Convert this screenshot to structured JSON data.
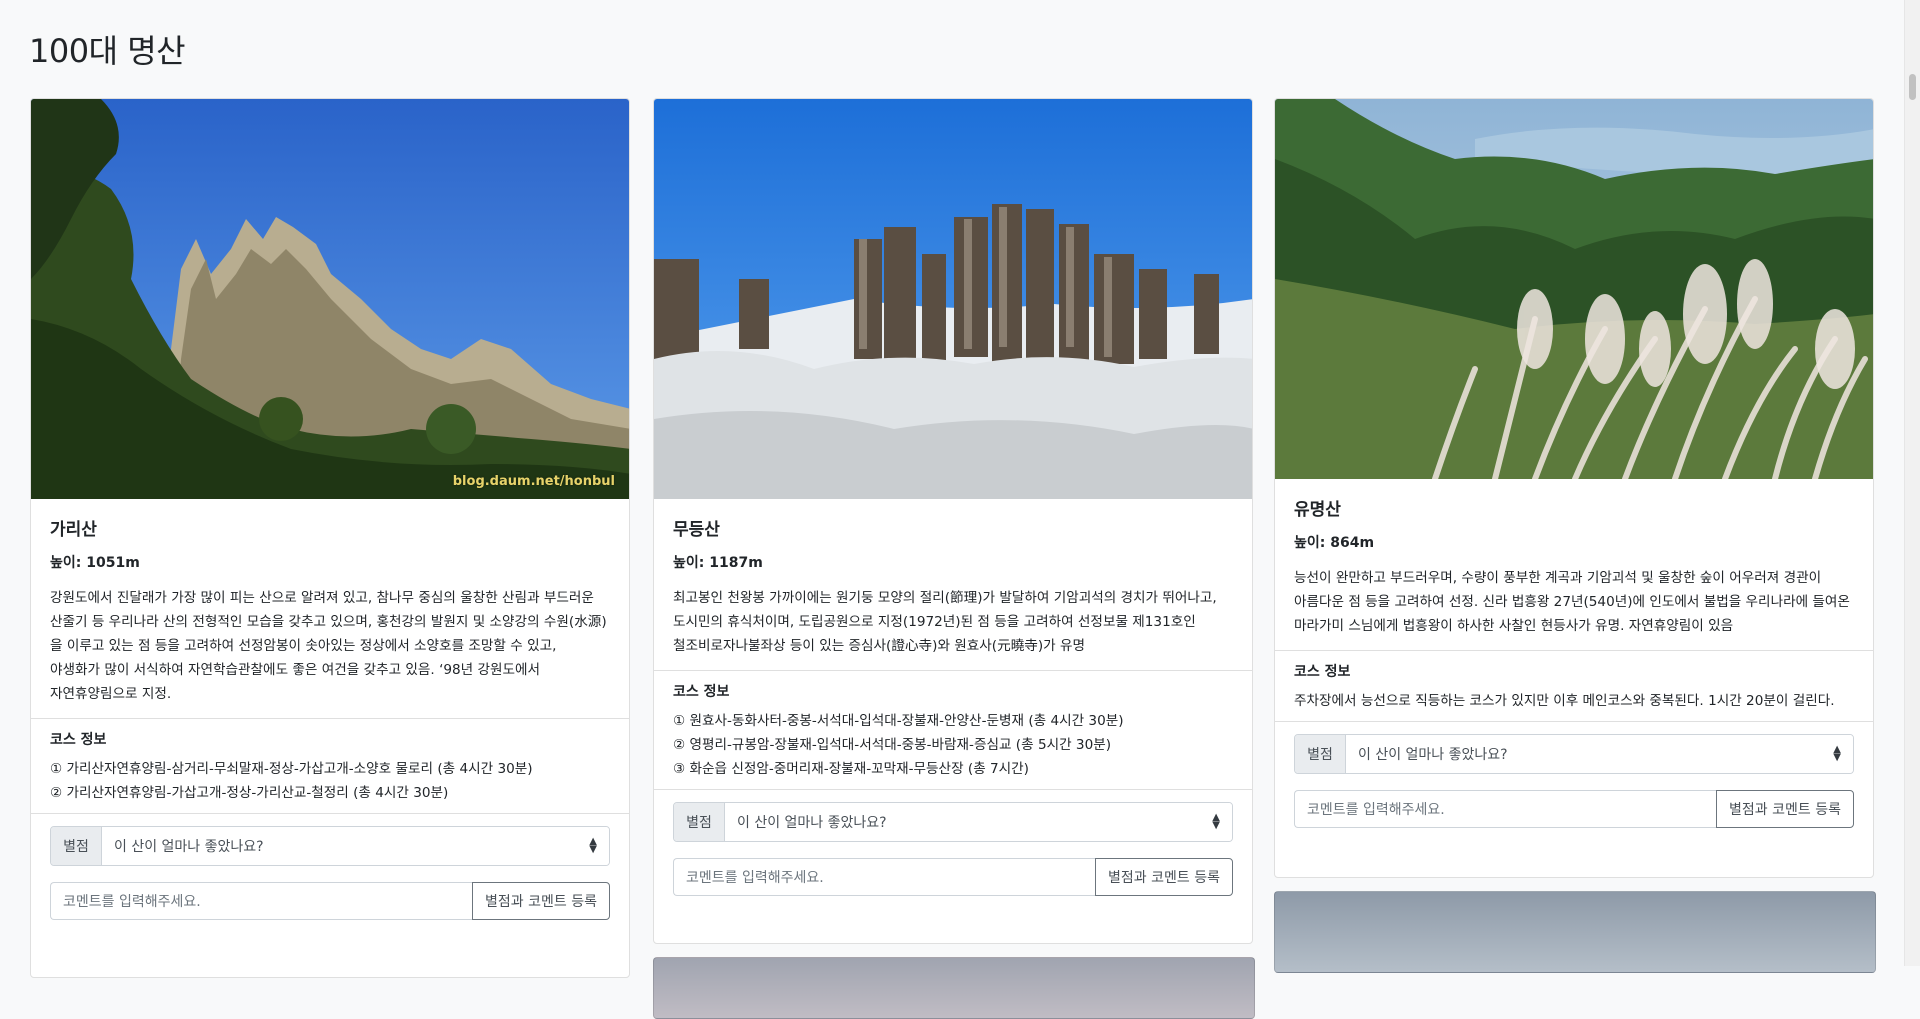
{
  "page": {
    "title": "100대 명산"
  },
  "form": {
    "rating_label": "별점",
    "rating_placeholder": "이 산이 얼마나 좋았나요?",
    "comment_placeholder": "코멘트를 입력해주세요.",
    "submit_label": "별점과 코멘트 등록"
  },
  "cards": [
    {
      "name": "가리산",
      "height": "높이: 1051m",
      "description": "강원도에서 진달래가 가장 많이 피는 산으로 알려져 있고, 참나무 중심의 울창한 산림과 부드러운 산줄기 등 우리나라 산의 전형적인 모습을 갖추고 있으며, 홍천강의 발원지 및 소양강의 수원(水源)을 이루고 있는 점 등을 고려하여 선정암봉이 솟아있는 정상에서 소양호를 조망할 수 있고, 야생화가 많이 서식하여 자연학습관찰에도 좋은 여건을 갖추고 있음. ‘98년 강원도에서 자연휴양림으로 지정.",
      "course_title": "코스 정보",
      "courses": [
        "① 가리산자연휴양림-삼거리-무쇠말재-정상-가삽고개-소양호 물로리 (총 4시간 30분)",
        "② 가리산자연휴양림-가삽고개-정상-가리산교-철정리 (총 4시간 30분)"
      ],
      "watermark": "blog.daum.net/honbul"
    },
    {
      "name": "무등산",
      "height": "높이: 1187m",
      "description": "최고봉인 천왕봉 가까이에는 원기둥 모양의 절리(節理)가 발달하여 기암괴석의 경치가 뛰어나고, 도시민의 휴식처이며, 도립공원으로 지정(1972년)된 점 등을 고려하여 선정보물 제131호인 철조비로자나불좌상 등이 있는 증심사(證心寺)와 원효사(元曉寺)가 유명",
      "course_title": "코스 정보",
      "courses": [
        "① 원효사-동화사터-중봉-서석대-입석대-장불재-안양산-둔병재 (총 4시간 30분)",
        "② 영평리-규봉암-장불재-입석대-서석대-중봉-바람재-증심교 (총 5시간 30분)",
        "③ 화순읍 신정암-중머리재-장불재-꼬막재-무등산장 (총 7시간)"
      ]
    },
    {
      "name": "유명산",
      "height": "높이: 864m",
      "description": "능선이 완만하고 부드러우며, 수량이 풍부한 계곡과 기암괴석 및 울창한 숲이 어우러져 경관이 아름다운 점 등을 고려하여 선정. 신라 법흥왕 27년(540년)에 인도에서 불법을 우리나라에 들여온 마라가미 스님에게 법흥왕이 하사한 사찰인 현등사가 유명. 자연휴양림이 있음",
      "course_title": "코스 정보",
      "courses": [
        "주차장에서 능선으로 직등하는 코스가 있지만 이후 메인코스와 중복된다. 1시간 20분이 걸린다."
      ]
    }
  ]
}
